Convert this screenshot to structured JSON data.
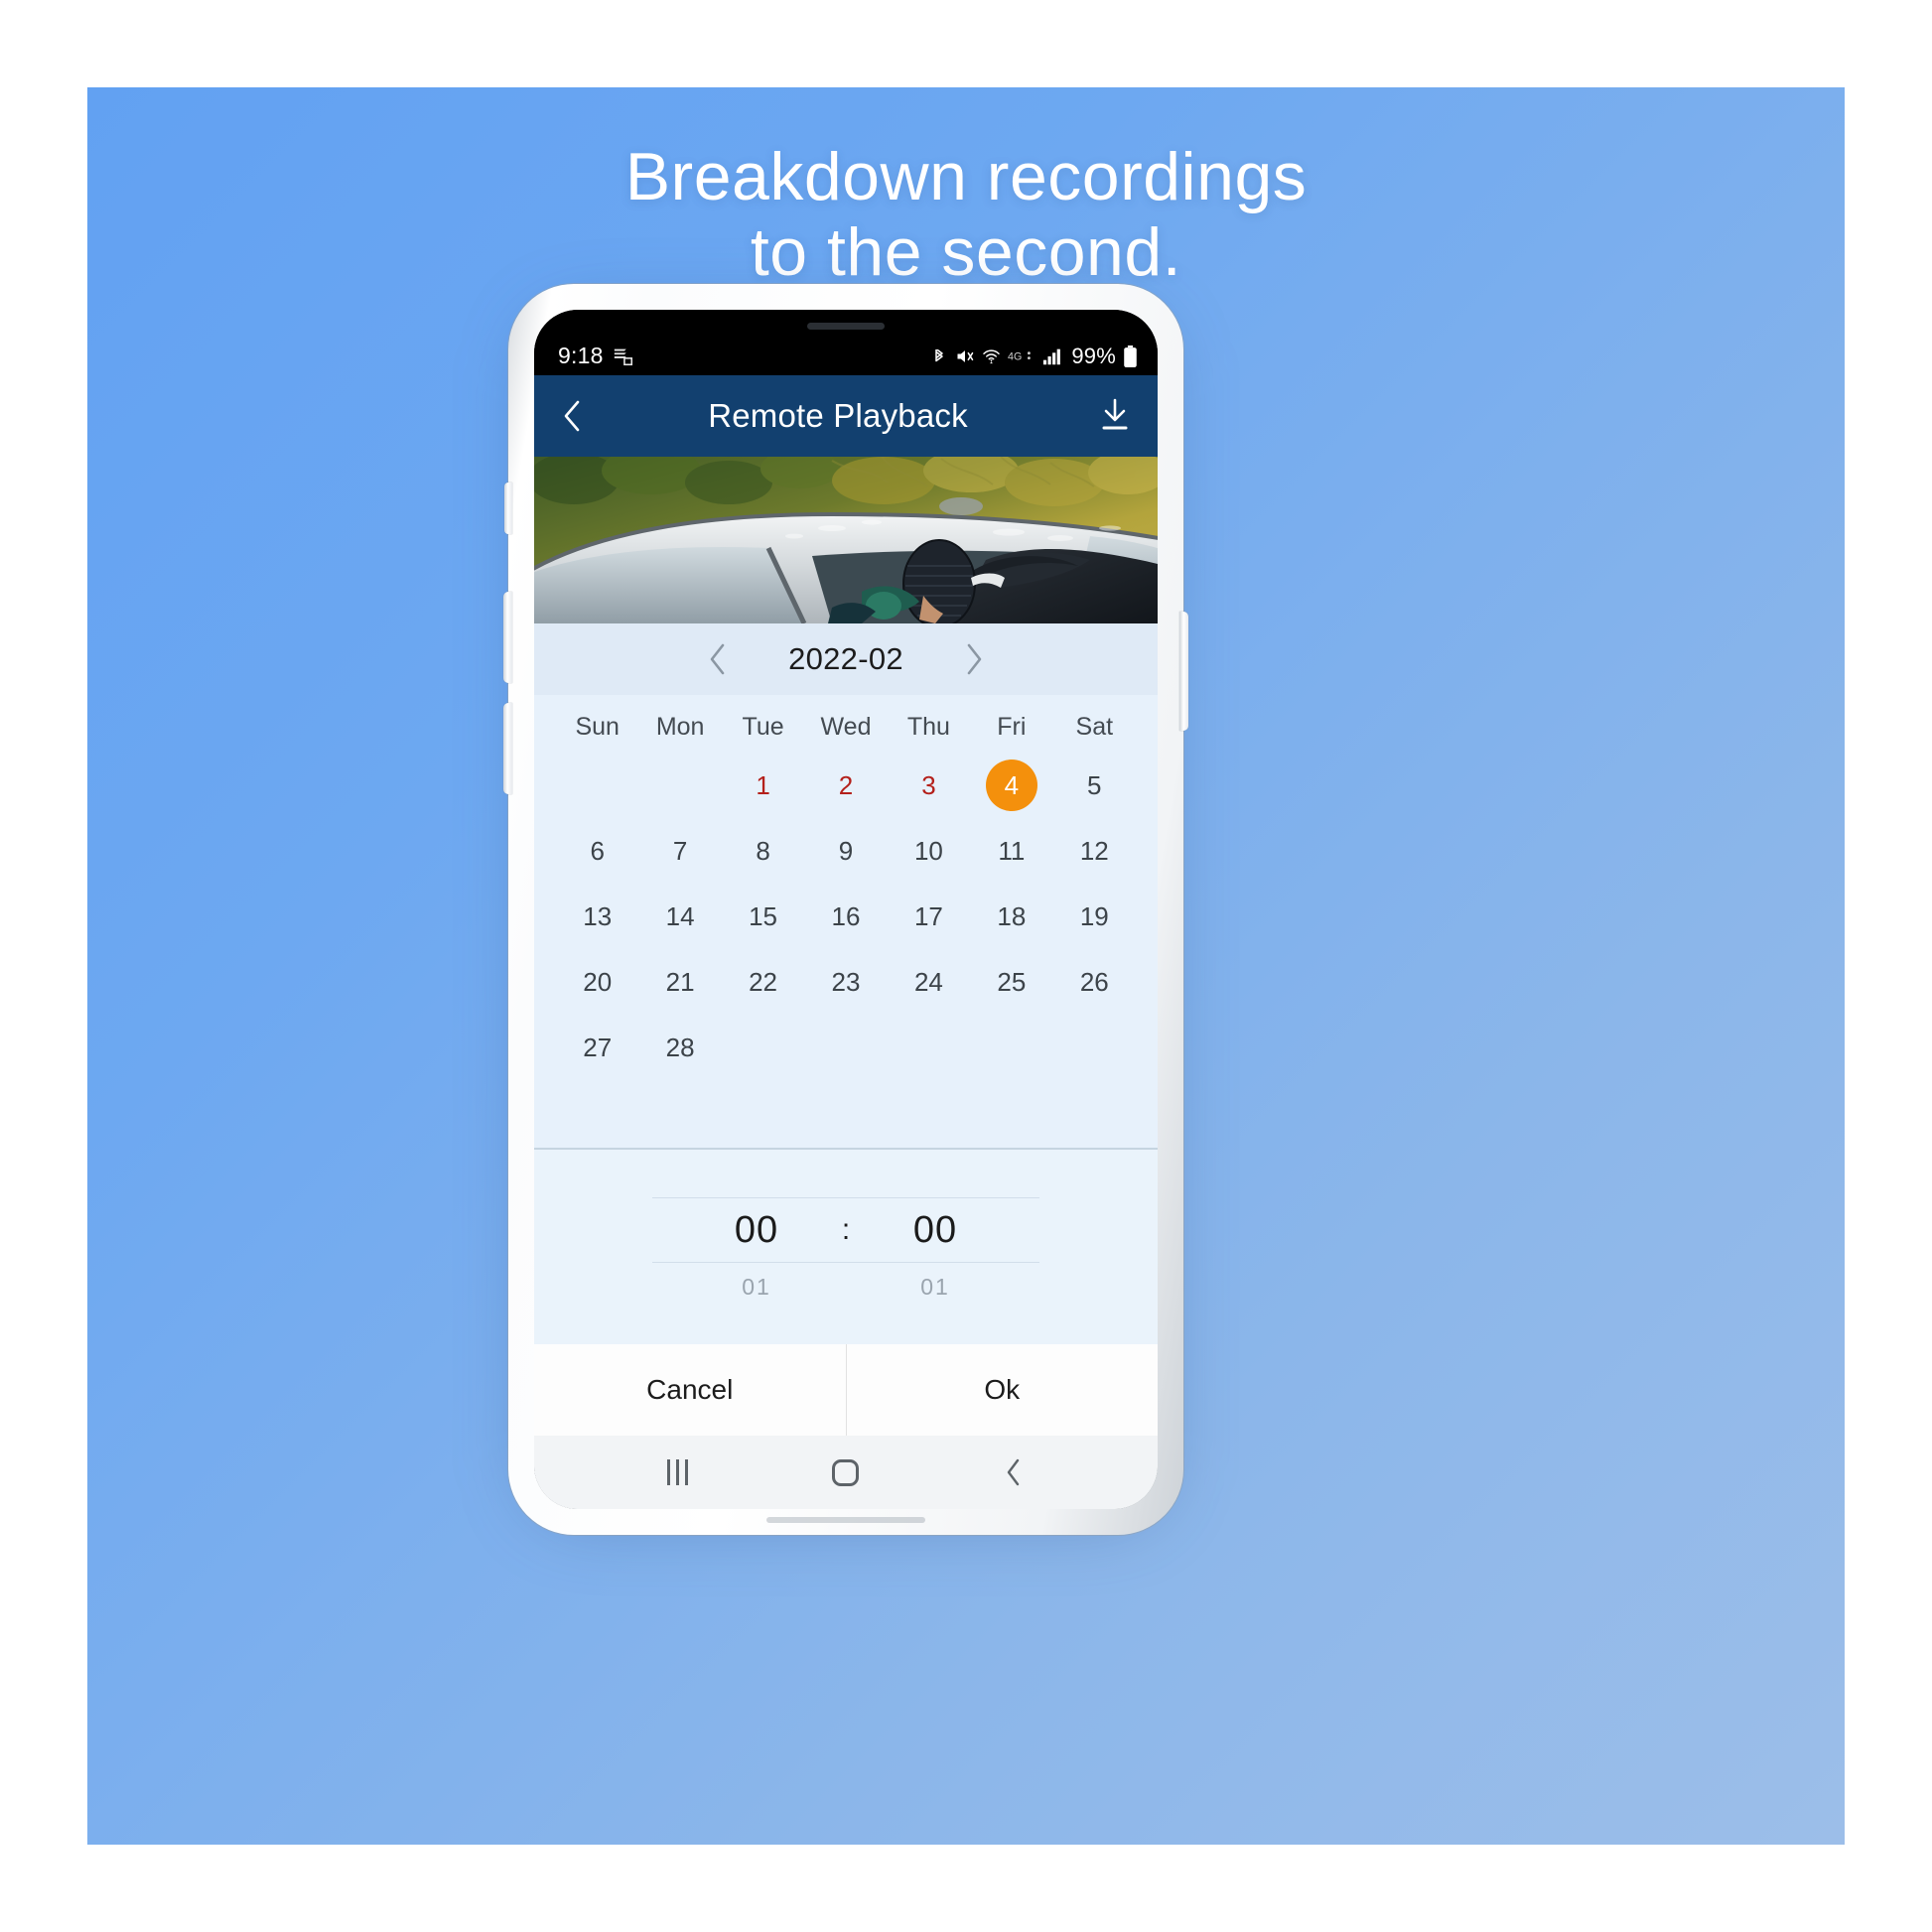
{
  "poster": {
    "headline_line1": "Breakdown recordings",
    "headline_line2": "to the second.",
    "background_color_top": "#62a1f2",
    "background_color_bottom": "#9cbee9"
  },
  "statusbar": {
    "time": "9:18",
    "notification_icon": "stacked-cards-icon",
    "bluetooth_icon": "bluetooth-icon",
    "sound_icon": "mute-vibrate-icon",
    "wifi_icon": "wifi-icon",
    "network_label": "4G",
    "signal_icon": "signal-bars-icon",
    "battery_percent": "99%",
    "battery_icon": "battery-full-icon"
  },
  "appbar": {
    "back_icon": "chevron-left-icon",
    "title": "Remote Playback",
    "download_icon": "download-icon",
    "background_color": "#12406f"
  },
  "video": {
    "description": "Security camera still of a hooded person in a balaclava reaching into a silver car window with autumn foliage behind"
  },
  "month_selector": {
    "prev_icon": "chevron-left-icon",
    "label": "2022-02",
    "next_icon": "chevron-right-icon"
  },
  "calendar": {
    "weekdays": [
      "Sun",
      "Mon",
      "Tue",
      "Wed",
      "Thu",
      "Fri",
      "Sat"
    ],
    "leading_blanks": 2,
    "rows": [
      [
        {
          "label": "",
          "style": "empty"
        },
        {
          "label": "",
          "style": "empty"
        },
        {
          "label": "1",
          "style": "red"
        },
        {
          "label": "2",
          "style": "red"
        },
        {
          "label": "3",
          "style": "red"
        },
        {
          "label": "4",
          "style": "sel"
        },
        {
          "label": "5",
          "style": "normal"
        }
      ],
      [
        {
          "label": "6",
          "style": "normal"
        },
        {
          "label": "7",
          "style": "normal"
        },
        {
          "label": "8",
          "style": "normal"
        },
        {
          "label": "9",
          "style": "normal"
        },
        {
          "label": "10",
          "style": "normal"
        },
        {
          "label": "11",
          "style": "normal"
        },
        {
          "label": "12",
          "style": "normal"
        }
      ],
      [
        {
          "label": "13",
          "style": "normal"
        },
        {
          "label": "14",
          "style": "normal"
        },
        {
          "label": "15",
          "style": "normal"
        },
        {
          "label": "16",
          "style": "normal"
        },
        {
          "label": "17",
          "style": "normal"
        },
        {
          "label": "18",
          "style": "normal"
        },
        {
          "label": "19",
          "style": "normal"
        }
      ],
      [
        {
          "label": "20",
          "style": "normal"
        },
        {
          "label": "21",
          "style": "normal"
        },
        {
          "label": "22",
          "style": "normal"
        },
        {
          "label": "23",
          "style": "normal"
        },
        {
          "label": "24",
          "style": "normal"
        },
        {
          "label": "25",
          "style": "normal"
        },
        {
          "label": "26",
          "style": "normal"
        }
      ],
      [
        {
          "label": "27",
          "style": "normal"
        },
        {
          "label": "28",
          "style": "normal"
        },
        {
          "label": "",
          "style": "empty"
        },
        {
          "label": "",
          "style": "empty"
        },
        {
          "label": "",
          "style": "empty"
        },
        {
          "label": "",
          "style": "empty"
        },
        {
          "label": "",
          "style": "empty"
        }
      ]
    ],
    "selected_day": "4",
    "selected_color": "#f4900c",
    "recording_day_color": "#b4201b"
  },
  "time_picker": {
    "hours_value": "00",
    "hours_next": "01",
    "separator": ":",
    "minutes_value": "00",
    "minutes_next": "01"
  },
  "actions": {
    "cancel_label": "Cancel",
    "ok_label": "Ok"
  },
  "navbar": {
    "recents_icon": "recents-icon",
    "home_icon": "home-icon",
    "back_icon": "back-chevron-icon"
  }
}
